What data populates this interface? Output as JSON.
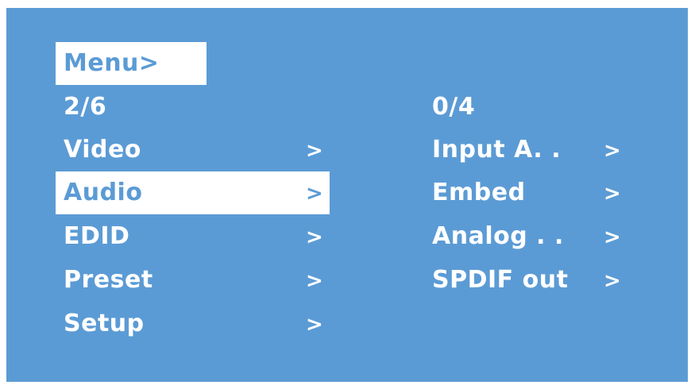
{
  "header": {
    "menu_label": "Menu>",
    "page_indicator": "2/6"
  },
  "left_menu": {
    "items": [
      {
        "label": "Video",
        "arrow": ">"
      },
      {
        "label": "Audio",
        "arrow": ">",
        "selected": true
      },
      {
        "label": "EDID",
        "arrow": ">"
      },
      {
        "label": "Preset",
        "arrow": ">"
      },
      {
        "label": "Setup",
        "arrow": ">"
      }
    ]
  },
  "right_menu": {
    "page_indicator": "0/4",
    "items": [
      {
        "label": "Input A. .",
        "arrow": ">"
      },
      {
        "label": "Embed",
        "arrow": ">"
      },
      {
        "label": "Analog . .",
        "arrow": ">"
      },
      {
        "label": "SPDIF out",
        "arrow": ">"
      }
    ]
  },
  "colors": {
    "background": "#5b9bd5",
    "text": "#ffffff",
    "highlight": "#ffffff"
  }
}
